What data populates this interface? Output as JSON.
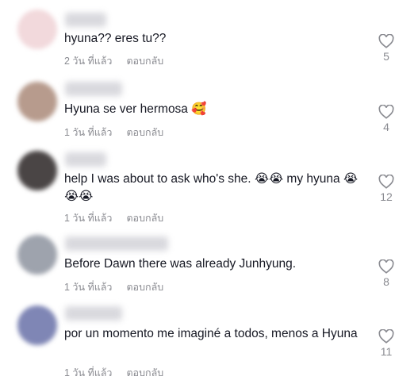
{
  "comments": [
    {
      "text": "hyuna?? eres tu??",
      "time": "2 วัน ที่แล้ว",
      "reply": "ตอบกลับ",
      "likes": "5",
      "avatar_color": "#f2d9dc"
    },
    {
      "text": "Hyuna se ver hermosa 🥰",
      "time": "1 วัน ที่แล้ว",
      "reply": "ตอบกลับ",
      "likes": "4",
      "avatar_color": "#b79b8d"
    },
    {
      "text": "help I was about to ask who's she. 😭😭 my hyuna 😭😭😭",
      "time": "1 วัน ที่แล้ว",
      "reply": "ตอบกลับ",
      "likes": "12",
      "avatar_color": "#4a4545"
    },
    {
      "text": "Before Dawn there was already Junhyung.",
      "time": "1 วัน ที่แล้ว",
      "reply": "ตอบกลับ",
      "likes": "8",
      "avatar_color": "#9ea3ad"
    },
    {
      "text": "por un momento me imaginé a todos, menos a Hyuna",
      "time": "1 วัน ที่แล้ว",
      "reply": "ตอบกลับ",
      "likes": "11",
      "avatar_color": "#7f86b5"
    }
  ]
}
